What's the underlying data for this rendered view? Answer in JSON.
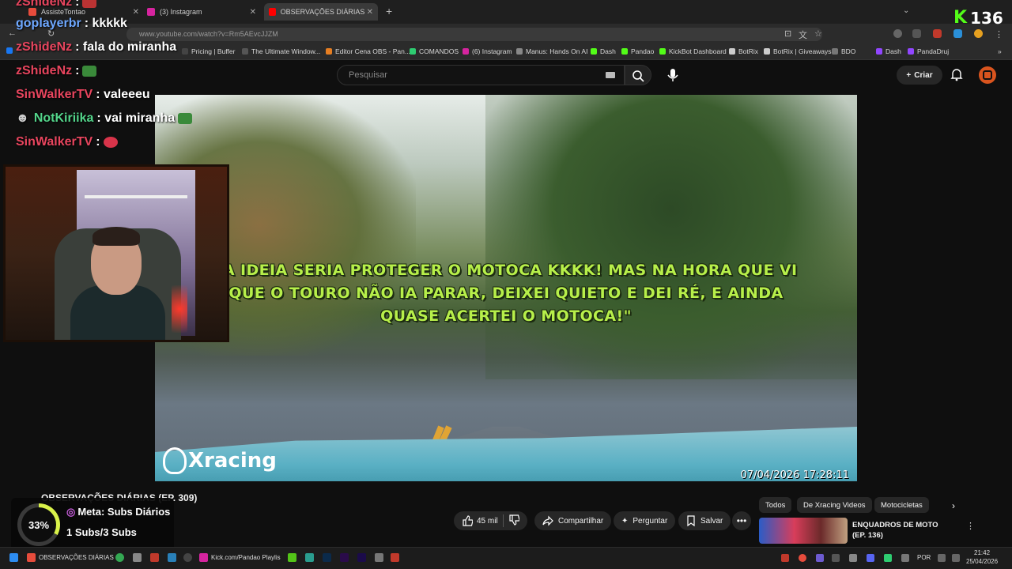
{
  "browser": {
    "tabs": [
      {
        "label": "AssisteTontao",
        "color": "#e74c3c"
      },
      {
        "label": "(3) Instagram",
        "color": "#d6249f"
      },
      {
        "label": "OBSERVAÇÕES DIÁRIAS (EP.",
        "color": "#ff0000"
      }
    ],
    "url": "www.youtube.com/watch?v=Rm5AEvcJJZM",
    "bookmarks": [
      {
        "label": "Pricing | Buffer",
        "color": "#444"
      },
      {
        "label": "The Ultimate Window...",
        "color": "#555"
      },
      {
        "label": "Editor Cena OBS - Pan...",
        "color": "#e67e22"
      },
      {
        "label": "COMANDOS",
        "color": "#2ecc71"
      },
      {
        "label": "(6) Instagram",
        "color": "#d6249f"
      },
      {
        "label": "Manus: Hands On AI",
        "color": "#888"
      },
      {
        "label": "Dash",
        "color": "#53fc18"
      },
      {
        "label": "Pandao",
        "color": "#53fc18"
      },
      {
        "label": "KickBot Dashboard",
        "color": "#53fc18"
      },
      {
        "label": "BotRix",
        "color": "#ccc"
      },
      {
        "label": "BotRix | Giveaways",
        "color": "#ccc"
      },
      {
        "label": "BDO",
        "color": "#777"
      },
      {
        "label": "Dash",
        "color": "#9146ff"
      },
      {
        "label": "PandaDruj",
        "color": "#9146ff"
      }
    ]
  },
  "youtube": {
    "search_placeholder": "Pesquisar",
    "create_label": "Criar",
    "video_title": "OBSERVAÇÕES DIÁRIAS (EP. 309)",
    "caption": "\"A IDEIA SERIA PROTEGER O MOTOCA KKKK! MAS NA HORA QUE VI QUE O TOURO NÃO IA PARAR, DEIXEI QUIETO E DEI RÉ, E AINDA QUASE ACERTEI O MOTOCA!\"",
    "watermark": "Xracing",
    "timestamp": "07/04/2026  17:28:11",
    "likes": "45 mil",
    "share_label": "Compartilhar",
    "ask_label": "Perguntar",
    "save_label": "Salvar",
    "tags": [
      "Todos",
      "De Xracing Videos",
      "Motocicletas"
    ],
    "suggestion_title": "ENQUADROS DE MOTO (EP. 136)"
  },
  "chat": [
    {
      "user": "zShideNz",
      "msg": ":",
      "color": "#e8455e",
      "emote": "#b33"
    },
    {
      "user": "goplayerbr",
      "msg": ": kkkkk",
      "color": "#6ea8ff",
      "emote": ""
    },
    {
      "user": "zShideNz",
      "msg": ": fala do miranha",
      "color": "#e8455e",
      "emote": ""
    },
    {
      "user": "zShideNz",
      "msg": ":",
      "color": "#e8455e",
      "emote": "#3a8a3a"
    },
    {
      "user": "SinWalkerTV",
      "msg": ": valeeeu",
      "color": "#e8455e",
      "emote": ""
    },
    {
      "user": "NotKiriika",
      "msg": ": vai miranha",
      "color": "#53d48a",
      "emote": "#3a8a3a"
    },
    {
      "user": "SinWalkerTV",
      "msg": ":",
      "color": "#e8455e",
      "emote": "#d8344a"
    }
  ],
  "overlay": {
    "goal_percent": "33%",
    "goal_fraction": 0.33,
    "goal_title": "Meta: Subs Diários",
    "goal_value": "1 Subs/3 Subs",
    "kick_count": "136"
  },
  "taskbar": {
    "items": [
      "OBSERVAÇÕES DIÁRIAS",
      "Kick.com/Pandao Playlis"
    ],
    "language": "POR",
    "time": "21:42",
    "date": "25/04/2026"
  }
}
